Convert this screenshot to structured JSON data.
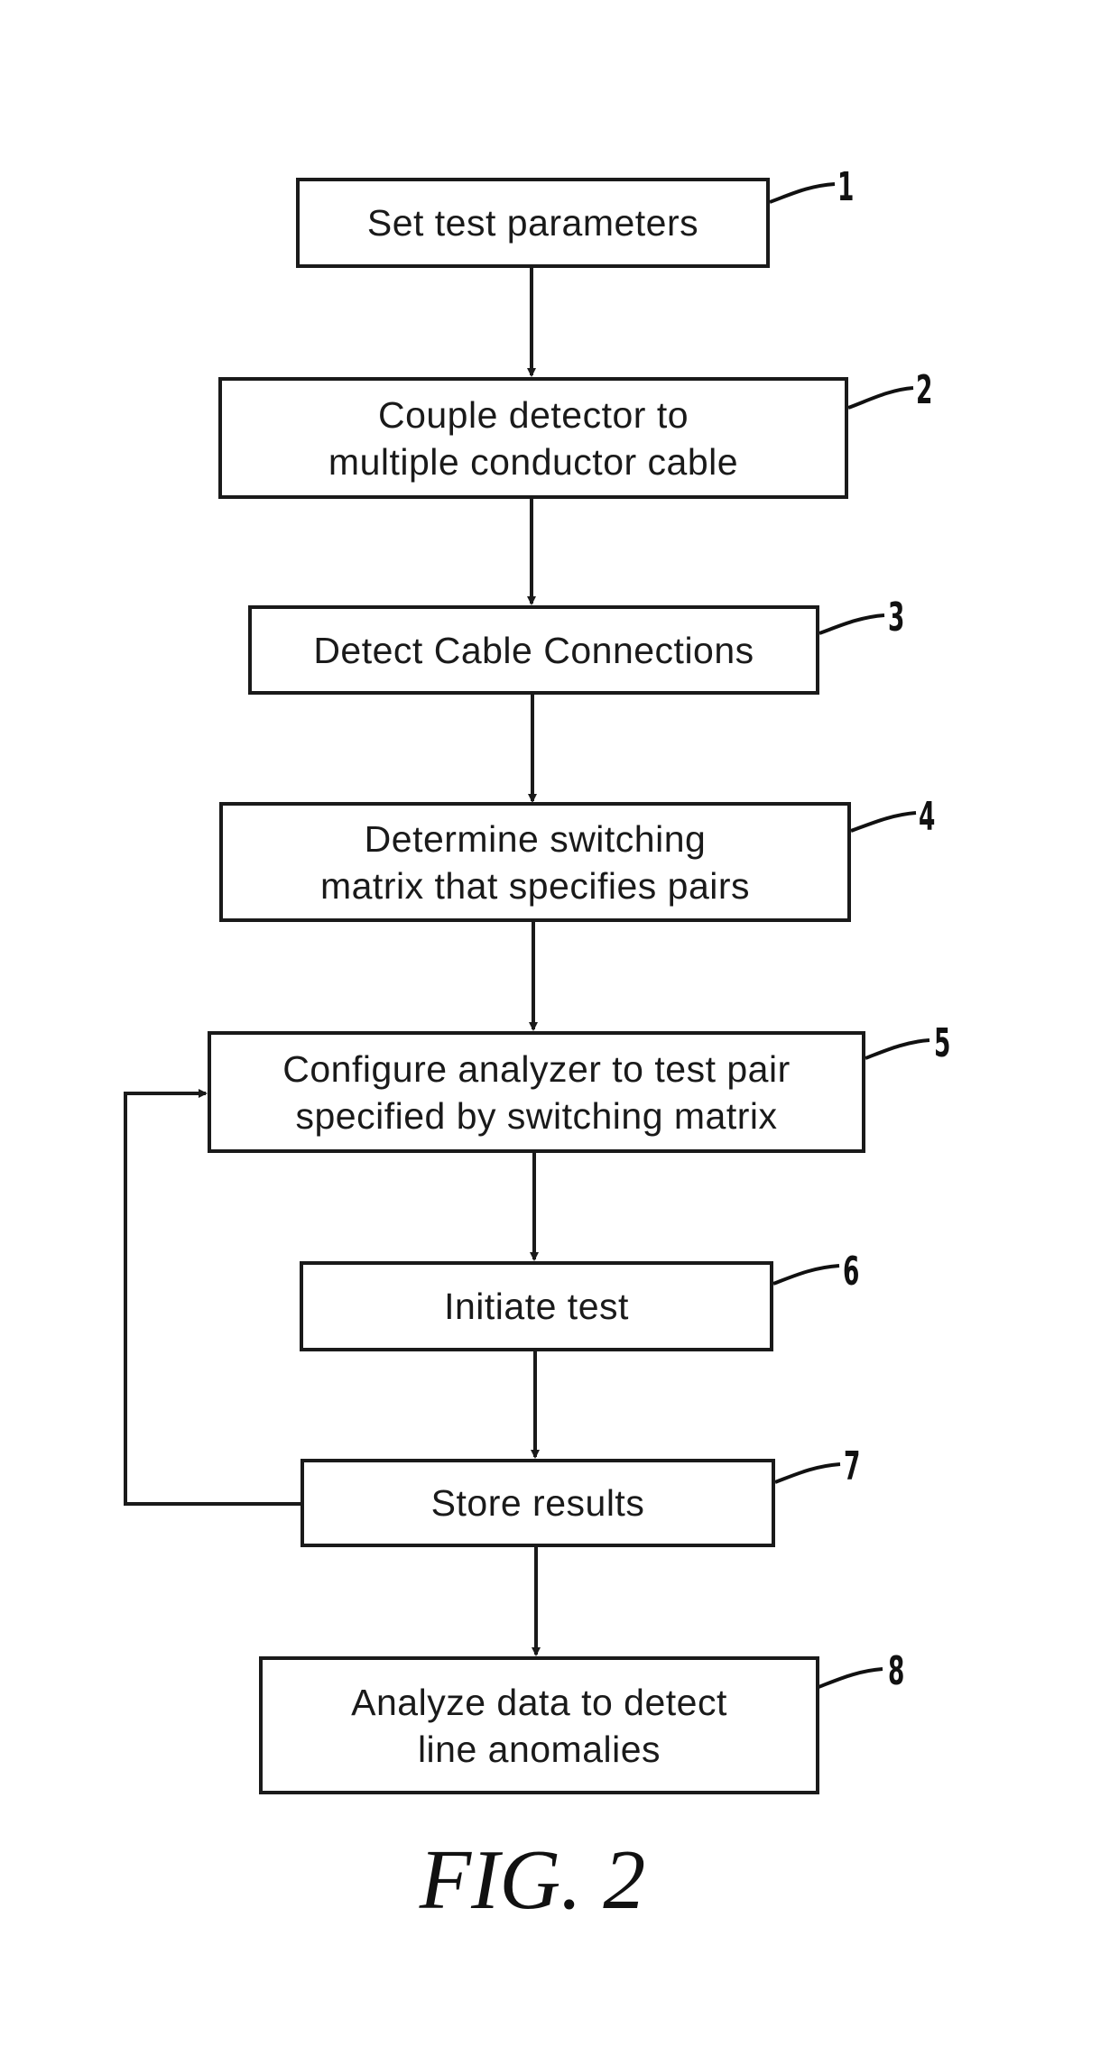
{
  "figure": {
    "caption": "FIG. 2",
    "steps": [
      {
        "ref": "1",
        "lines": [
          "Set test parameters"
        ]
      },
      {
        "ref": "2",
        "lines": [
          "Couple detector to",
          "multiple conductor cable"
        ]
      },
      {
        "ref": "3",
        "lines": [
          "Detect Cable Connections"
        ]
      },
      {
        "ref": "4",
        "lines": [
          "Determine switching",
          "matrix that specifies pairs"
        ]
      },
      {
        "ref": "5",
        "lines": [
          "Configure analyzer to test pair",
          "specified by switching matrix"
        ]
      },
      {
        "ref": "6",
        "lines": [
          "Initiate test"
        ]
      },
      {
        "ref": "7",
        "lines": [
          "Store results"
        ]
      },
      {
        "ref": "8",
        "lines": [
          "Analyze data to detect",
          "line anomalies"
        ]
      }
    ],
    "connections": [
      {
        "from": "1",
        "to": "2"
      },
      {
        "from": "2",
        "to": "3"
      },
      {
        "from": "3",
        "to": "4"
      },
      {
        "from": "4",
        "to": "5"
      },
      {
        "from": "5",
        "to": "6"
      },
      {
        "from": "6",
        "to": "7"
      },
      {
        "from": "7",
        "to": "8"
      },
      {
        "from": "7",
        "to": "5",
        "type": "loop-back"
      }
    ],
    "colors": {
      "ink": "#1a1a1a",
      "background": "#ffffff"
    }
  }
}
